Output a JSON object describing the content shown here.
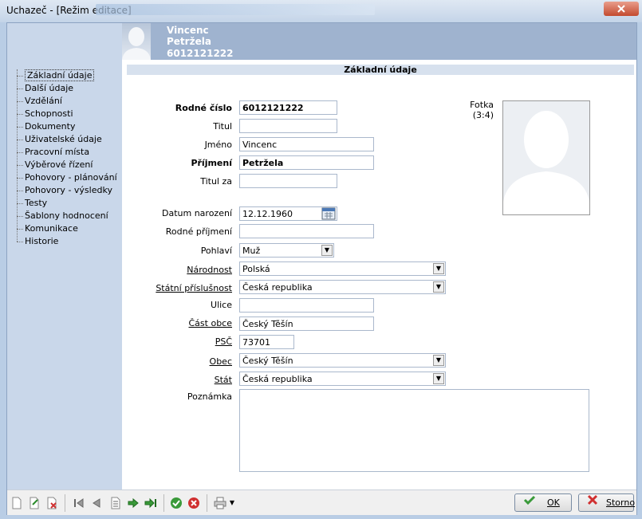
{
  "window": {
    "title": "Uchazeč - [Režim editace]"
  },
  "header": {
    "first_name": "Vincenc",
    "last_name": "Petržela",
    "id": "6012121222"
  },
  "nav": {
    "items": [
      "Základní údaje",
      "Další údaje",
      "Vzdělání",
      "Schopnosti",
      "Dokumenty",
      "Uživatelské údaje",
      "Pracovní místa",
      "Výběrové řízení",
      "Pohovory - plánování",
      "Pohovory - výsledky",
      "Testy",
      "Šablony hodnocení",
      "Komunikace",
      "Historie"
    ]
  },
  "section_title": "Základní údaje",
  "form": {
    "rodne_cislo": {
      "label": "Rodné číslo",
      "value": "6012121222"
    },
    "titul": {
      "label": "Titul",
      "value": ""
    },
    "jmeno": {
      "label": "Jméno",
      "value": "Vincenc"
    },
    "prijmeni": {
      "label": "Příjmení",
      "value": "Petržela"
    },
    "titul_za": {
      "label": "Titul za",
      "value": ""
    },
    "datum_narozeni": {
      "label": "Datum narození",
      "value": "12.12.1960"
    },
    "rodne_prijmeni": {
      "label": "Rodné příjmení",
      "value": ""
    },
    "pohlavi": {
      "label": "Pohlaví",
      "value": "Muž"
    },
    "narodnost": {
      "label": "Národnost",
      "value": "Polská"
    },
    "statni_prislusnost": {
      "label": "Státní příslušnost",
      "value": "Česká republika"
    },
    "ulice": {
      "label": "Ulice",
      "value": ""
    },
    "cast_obce": {
      "label": "Část obce",
      "value": "Český Těšín"
    },
    "psc": {
      "label": "PSČ",
      "value": "73701"
    },
    "obec": {
      "label": "Obec",
      "value": "Český Těšín"
    },
    "stat": {
      "label": "Stát",
      "value": "Česká republika"
    },
    "poznamka": {
      "label": "Poznámka",
      "value": ""
    }
  },
  "photo": {
    "label_line1": "Fotka",
    "label_line2": "(3:4)"
  },
  "buttons": {
    "ok": "OK",
    "storno": "Storno"
  },
  "icons": [
    "new-icon",
    "edit-icon",
    "delete-icon",
    "first-icon",
    "prev-icon",
    "list-icon",
    "next-icon",
    "last-icon",
    "confirm-icon",
    "cancel-icon",
    "print-icon",
    "calendar-icon",
    "chevron-down-icon"
  ],
  "colors": {
    "sidebar": "#c9d7ea",
    "header": "#9fb3cf",
    "confirm": "#3a9a3a",
    "cancel": "#d03030"
  }
}
